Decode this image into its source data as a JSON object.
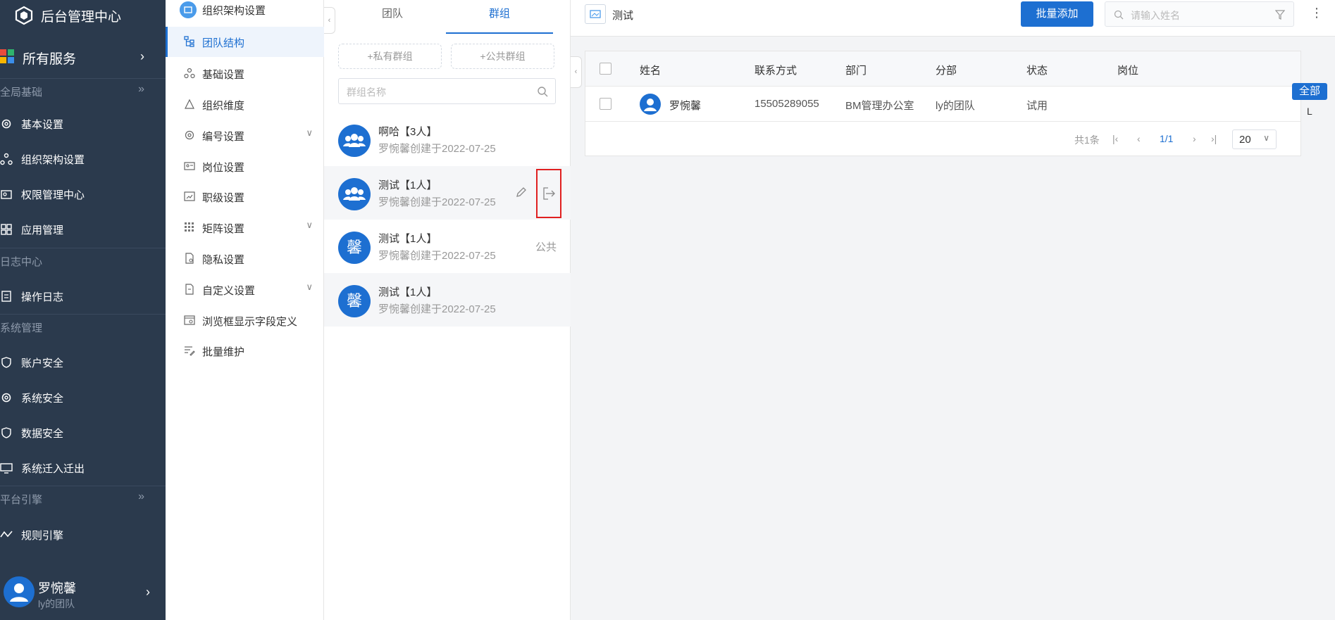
{
  "nav": {
    "app_title": "后台管理中心",
    "all_services": "所有服务",
    "sections": [
      {
        "title": "全局基础"
      },
      {
        "title": "日志中心"
      },
      {
        "title": "系统管理"
      },
      {
        "title": "平台引擎"
      }
    ],
    "items": [
      {
        "label": "基本设置",
        "icon": "gear-icon"
      },
      {
        "label": "组织架构设置",
        "icon": "org-icon"
      },
      {
        "label": "权限管理中心",
        "icon": "permission-icon"
      },
      {
        "label": "应用管理",
        "icon": "apps-icon"
      },
      {
        "label": "操作日志",
        "icon": "log-icon"
      },
      {
        "label": "账户安全",
        "icon": "shield-icon"
      },
      {
        "label": "系统安全",
        "icon": "gear-icon"
      },
      {
        "label": "数据安全",
        "icon": "shield-icon"
      },
      {
        "label": "系统迁入迁出",
        "icon": "monitor-icon"
      },
      {
        "label": "规则引擎",
        "icon": "rule-icon"
      }
    ],
    "user": {
      "name": "罗惋馨",
      "team": "ly的团队"
    }
  },
  "settings": {
    "header": "组织架构设置",
    "items": [
      {
        "label": "团队结构"
      },
      {
        "label": "基础设置"
      },
      {
        "label": "组织维度"
      },
      {
        "label": "编号设置"
      },
      {
        "label": "岗位设置"
      },
      {
        "label": "职级设置"
      },
      {
        "label": "矩阵设置"
      },
      {
        "label": "隐私设置"
      },
      {
        "label": "自定义设置"
      },
      {
        "label": "浏览框显示字段定义"
      },
      {
        "label": "批量维护"
      }
    ]
  },
  "groups": {
    "tabs": [
      "团队",
      "群组"
    ],
    "add_private": "+私有群组",
    "add_public": "+公共群组",
    "search_placeholder": "群组名称",
    "list": [
      {
        "name": "啊哈【3人】",
        "sub": "罗惋馨创建于2022-07-25",
        "avatar": ""
      },
      {
        "name": "测试【1人】",
        "sub": "罗惋馨创建于2022-07-25",
        "avatar": ""
      },
      {
        "name": "测试【1人】",
        "sub": "罗惋馨创建于2022-07-25",
        "avatar": "馨",
        "tag": "公共"
      },
      {
        "name": "测试【1人】",
        "sub": "罗惋馨创建于2022-07-25",
        "avatar": "馨"
      }
    ]
  },
  "main": {
    "title": "测试",
    "batch_add": "批量添加",
    "search_placeholder": "请输入姓名",
    "columns": [
      "姓名",
      "联系方式",
      "部门",
      "分部",
      "状态",
      "岗位"
    ],
    "rows": [
      {
        "name": "罗惋馨",
        "phone": "15505289055",
        "dept": "BM管理办公室",
        "branch": "ly的团队",
        "status": "试用",
        "post": ""
      }
    ],
    "pager": {
      "total": "共1条",
      "page": "1/1",
      "size": "20"
    },
    "filter_all": "全部",
    "filter_letter": "L"
  },
  "colors": {
    "accent": "#1d6fd1",
    "nav_bg": "#2b3a4d",
    "highlight_border": "#e02020"
  }
}
